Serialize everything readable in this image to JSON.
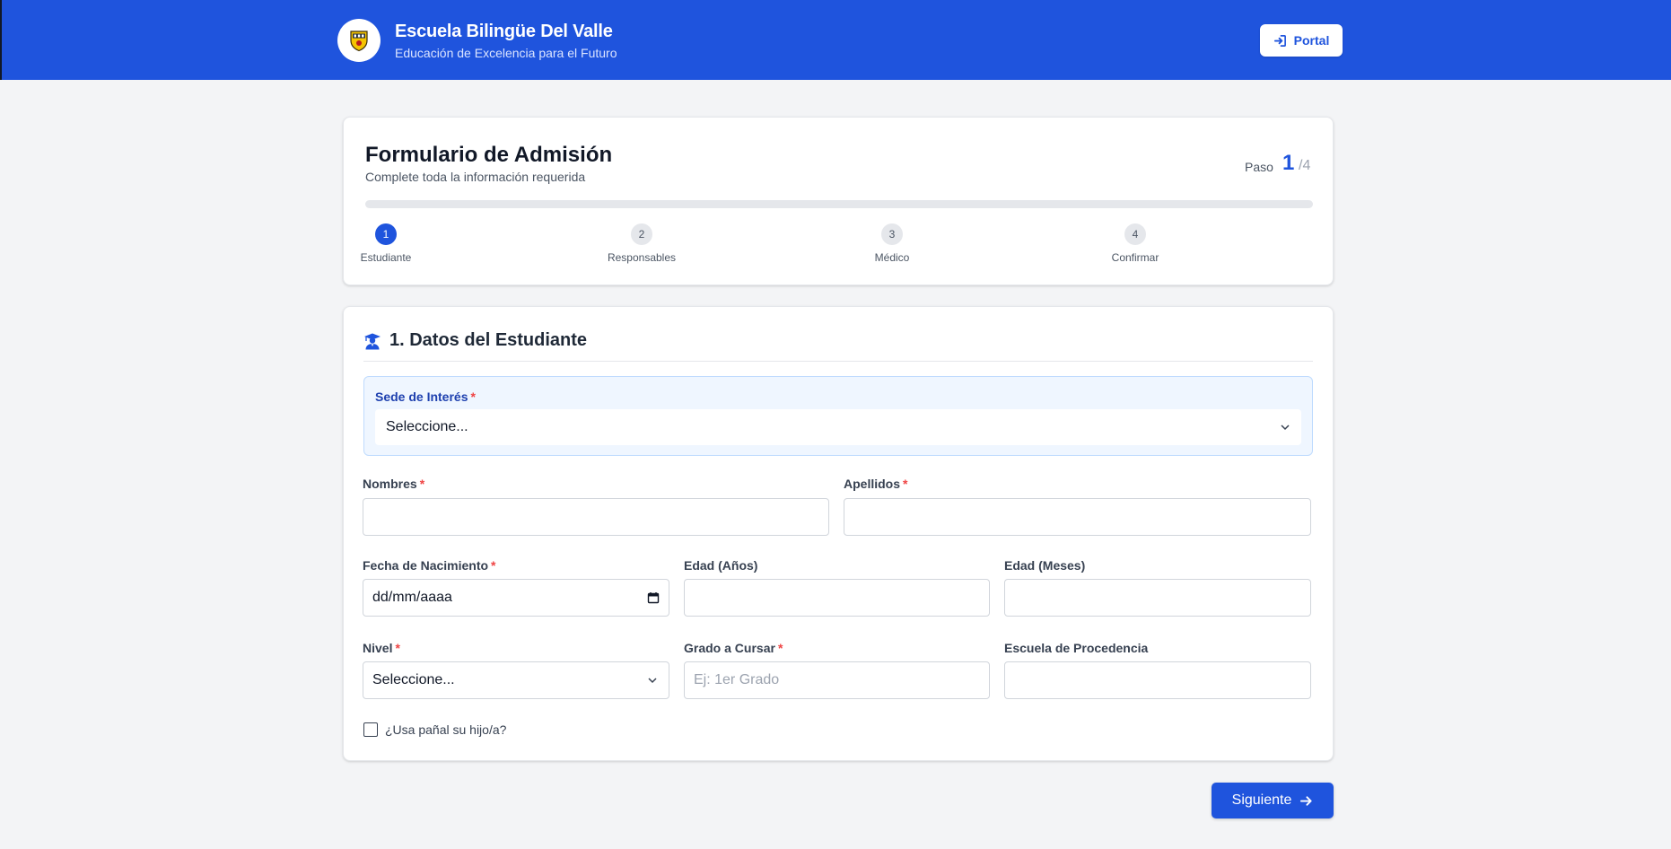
{
  "header": {
    "school_name": "Escuela Bilingüe Del Valle",
    "tagline": "Educación de Excelencia para el Futuro",
    "portal_label": "Portal",
    "logo_icon": "school-crest-icon",
    "portal_icon": "sign-in-icon"
  },
  "progress": {
    "title": "Formulario de Admisión",
    "subtitle": "Complete toda la información requerida",
    "paso_label": "Paso",
    "current_step": "1",
    "total_steps": "/4",
    "fill_fraction": 0,
    "steps": [
      {
        "number": "1",
        "label": "Estudiante",
        "active": true
      },
      {
        "number": "2",
        "label": "Responsables",
        "active": false
      },
      {
        "number": "3",
        "label": "Médico",
        "active": false
      },
      {
        "number": "4",
        "label": "Confirmar",
        "active": false
      }
    ]
  },
  "form": {
    "section_title": "1. Datos del Estudiante",
    "section_icon": "student-graduate-icon",
    "sede": {
      "label": "Sede de Interés",
      "required_mark": "*",
      "value": "Seleccione..."
    },
    "nombres": {
      "label": "Nombres",
      "required_mark": "*",
      "value": ""
    },
    "apellidos": {
      "label": "Apellidos",
      "required_mark": "*",
      "value": ""
    },
    "fecha_nacimiento": {
      "label": "Fecha de Nacimiento",
      "required_mark": "*",
      "value": "dd/mm/aaaa"
    },
    "edad_anios": {
      "label": "Edad (Años)",
      "value": ""
    },
    "edad_meses": {
      "label": "Edad (Meses)",
      "value": ""
    },
    "nivel": {
      "label": "Nivel",
      "required_mark": "*",
      "value": "Seleccione..."
    },
    "grado": {
      "label": "Grado a Cursar",
      "required_mark": "*",
      "placeholder": "Ej: 1er Grado"
    },
    "escuela_procedencia": {
      "label": "Escuela de Procedencia",
      "value": ""
    },
    "panal": {
      "label": "¿Usa pañal su hijo/a?",
      "checked": false
    }
  },
  "actions": {
    "next_label": "Siguiente",
    "next_icon": "arrow-right-icon"
  },
  "colors": {
    "primary": "#1f54dd",
    "required": "#ef4444",
    "sede_bg": "#eff6ff"
  }
}
